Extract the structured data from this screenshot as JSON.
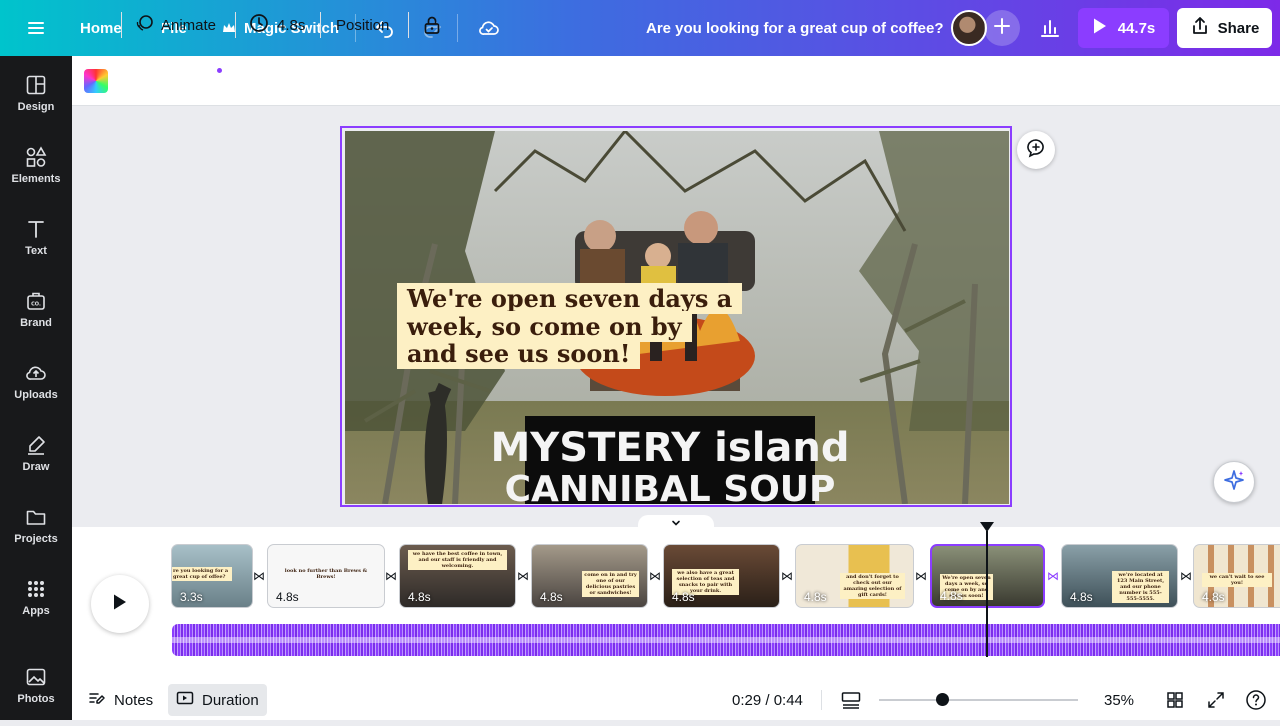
{
  "topbar": {
    "home": "Home",
    "file": "File",
    "magic_switch": "Magic Switch",
    "title": "Are you looking for a great cup of coffee?",
    "present_duration": "44.7s",
    "share": "Share"
  },
  "sidebar": {
    "items": [
      {
        "label": "Design",
        "icon": "design-icon"
      },
      {
        "label": "Elements",
        "icon": "elements-icon"
      },
      {
        "label": "Text",
        "icon": "text-icon"
      },
      {
        "label": "Brand",
        "icon": "brand-icon"
      },
      {
        "label": "Uploads",
        "icon": "uploads-icon"
      },
      {
        "label": "Draw",
        "icon": "draw-icon"
      },
      {
        "label": "Projects",
        "icon": "projects-icon"
      },
      {
        "label": "Apps",
        "icon": "apps-icon"
      },
      {
        "label": "Photos",
        "icon": "photos-icon"
      }
    ]
  },
  "toolbar": {
    "animate": "Animate",
    "duration": "4.8s",
    "position": "Position"
  },
  "canvas": {
    "caption": "We're open seven days a week, so come on by and see us soon!",
    "sign_line1": "MYSTERY island",
    "sign_line2": "CANNIBAL SOUP"
  },
  "timeline": {
    "clips": [
      {
        "duration": "3.3s",
        "text": "re you looking for a great cup of offee?"
      },
      {
        "duration": "4.8s",
        "text": "look no further than Brews & Brews!"
      },
      {
        "duration": "4.8s",
        "text": "we have the best coffee in town, and our staff is friendly and welcoming."
      },
      {
        "duration": "4.8s",
        "text": "come on in and try one of our delicious pastries or sandwiches!"
      },
      {
        "duration": "4.8s",
        "text": "we also have a great selection of teas and snacks to pair with your drink."
      },
      {
        "duration": "4.8s",
        "text": "and don't forget to check out our amazing selection of gift cards!"
      },
      {
        "duration": "4.8s",
        "text": "We're open seven days a week, so come on by and see us soon!"
      },
      {
        "duration": "4.8s",
        "text": "we're located at 123 Main Street, and our phone number is 555-555-5555."
      },
      {
        "duration": "4.8s",
        "text": "we can't wait to see you!"
      }
    ]
  },
  "bottombar": {
    "notes": "Notes",
    "duration": "Duration",
    "time": "0:29 / 0:44",
    "zoom": "35%",
    "zoom_fraction": 0.35
  },
  "colors": {
    "accent": "#8b3dff",
    "caption_bg": "#fdf0c4",
    "caption_text": "#3a1e0c"
  }
}
